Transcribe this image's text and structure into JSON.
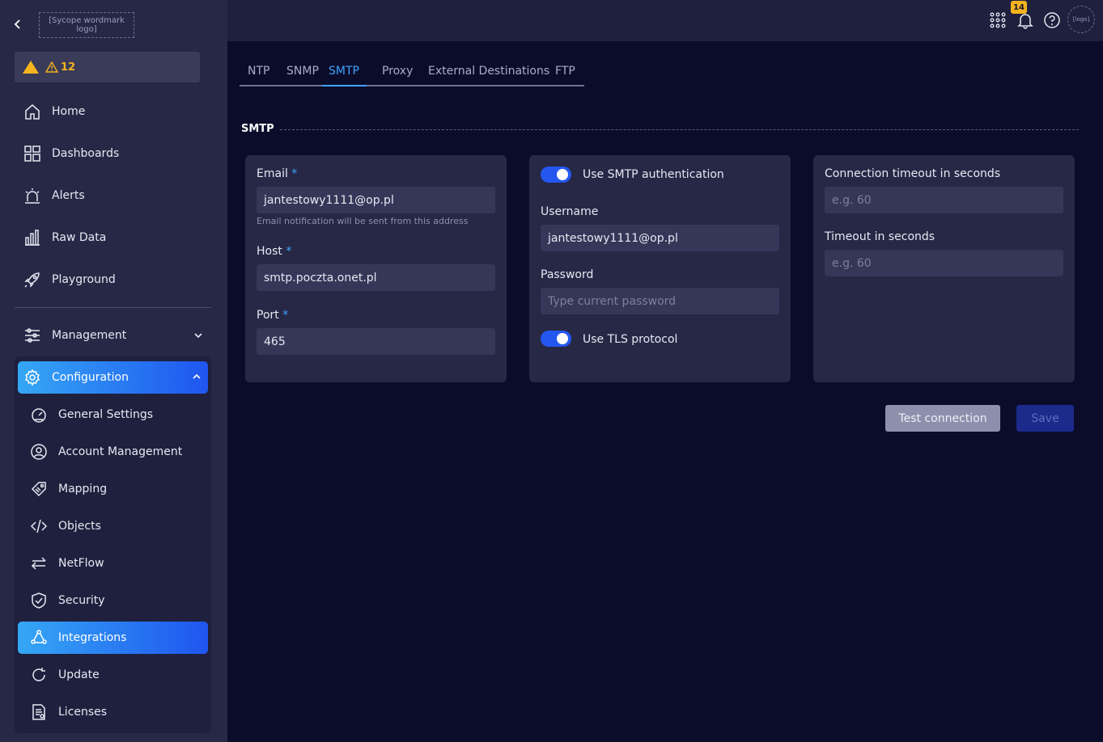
{
  "sidebar": {
    "alerts_count": "12",
    "nav": [
      {
        "label": "Home"
      },
      {
        "label": "Dashboards"
      },
      {
        "label": "Alerts"
      },
      {
        "label": "Raw Data"
      },
      {
        "label": "Playground"
      }
    ],
    "management_label": "Management",
    "configuration_label": "Configuration",
    "config_items": [
      {
        "label": "General Settings"
      },
      {
        "label": "Account Management"
      },
      {
        "label": "Mapping"
      },
      {
        "label": "Objects"
      },
      {
        "label": "NetFlow"
      },
      {
        "label": "Security"
      },
      {
        "label": "Integrations"
      },
      {
        "label": "Update"
      },
      {
        "label": "Licenses"
      }
    ]
  },
  "topbar": {
    "notification_count": "14"
  },
  "tabs": [
    "NTP",
    "SNMP",
    "SMTP",
    "Proxy",
    "External Destinations",
    "FTP"
  ],
  "section_title": "SMTP",
  "card1": {
    "email_label": "Email",
    "email_value": "jantestowy1111@op.pl",
    "email_hint": "Email notification will be sent from this address",
    "host_label": "Host",
    "host_value": "smtp.poczta.onet.pl",
    "port_label": "Port",
    "port_value": "465",
    "required_mark": "*"
  },
  "card2": {
    "auth_toggle_label": "Use SMTP authentication",
    "username_label": "Username",
    "username_value": "jantestowy1111@op.pl",
    "password_label": "Password",
    "password_placeholder": "Type current password",
    "tls_toggle_label": "Use TLS protocol"
  },
  "card3": {
    "conn_timeout_label": "Connection timeout in seconds",
    "conn_timeout_placeholder": "e.g. 60",
    "timeout_label": "Timeout in seconds",
    "timeout_placeholder": "e.g. 60"
  },
  "buttons": {
    "test": "Test connection",
    "save": "Save"
  },
  "colors": {
    "accent": "#3fa3ff",
    "warning": "#f6b41d",
    "toggle_on": "#2357f0"
  }
}
